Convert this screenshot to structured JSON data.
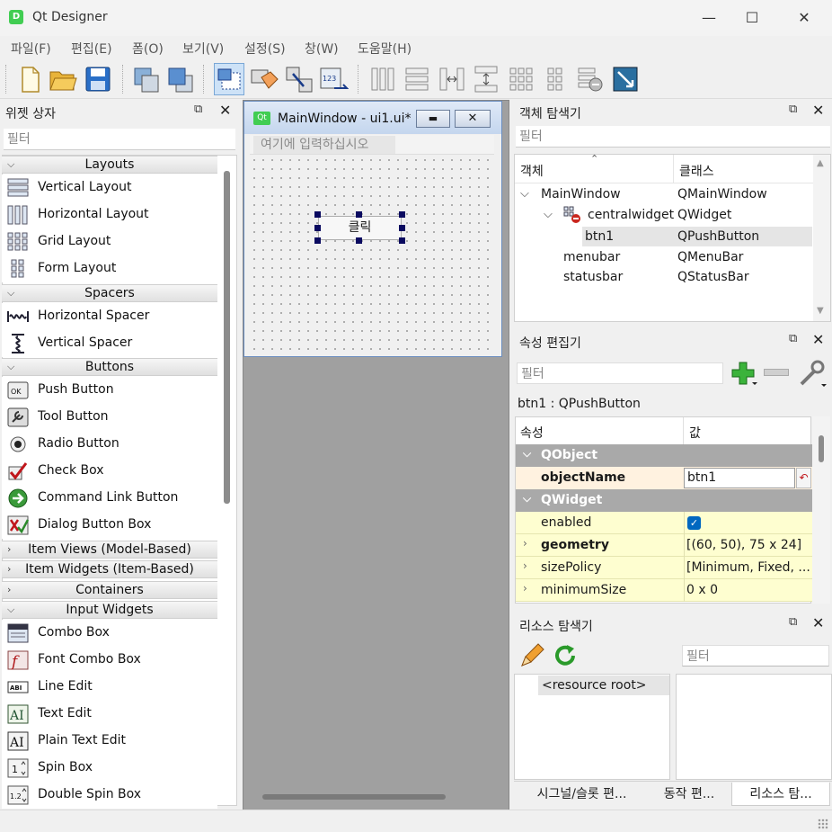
{
  "app": {
    "title": "Qt Designer",
    "logo": "D"
  },
  "window_controls": {
    "minimize": "—",
    "maximize": "☐",
    "close": "✕"
  },
  "menu": [
    "파일(F)",
    "편집(E)",
    "폼(O)",
    "보기(V)",
    "설정(S)",
    "창(W)",
    "도움말(H)"
  ],
  "toolbar": [
    "new-file-icon",
    "open-folder-icon",
    "save-icon",
    "send-to-back-icon",
    "bring-to-front-icon",
    "edit-widgets-icon",
    "edit-buddies-icon",
    "edit-signals-icon",
    "edit-tab-order-icon",
    "layout-horizontal-icon",
    "layout-vertical-icon",
    "layout-horizontal-splitter-icon",
    "layout-vertical-splitter-icon",
    "layout-grid-icon",
    "layout-form-icon",
    "break-layout-icon",
    "adjust-size-icon"
  ],
  "widget_box": {
    "title": "위젯 상자",
    "filter_placeholder": "필터",
    "cat_layouts": "Layouts",
    "layouts": [
      "Vertical Layout",
      "Horizontal Layout",
      "Grid Layout",
      "Form Layout"
    ],
    "cat_spacers": "Spacers",
    "spacers": [
      "Horizontal Spacer",
      "Vertical Spacer"
    ],
    "cat_buttons": "Buttons",
    "buttons": [
      "Push Button",
      "Tool Button",
      "Radio Button",
      "Check Box",
      "Command Link Button",
      "Dialog Button Box"
    ],
    "cat_item_views": "Item Views (Model-Based)",
    "cat_item_widgets": "Item Widgets (Item-Based)",
    "cat_containers": "Containers",
    "cat_input": "Input Widgets",
    "inputs": [
      "Combo Box",
      "Font Combo Box",
      "Line Edit",
      "Text Edit",
      "Plain Text Edit",
      "Spin Box",
      "Double Spin Box"
    ]
  },
  "form": {
    "title": "MainWindow - ui1.ui*",
    "menu_placeholder": "여기에 입력하십시오",
    "button_text": "클릭"
  },
  "object_inspector": {
    "title": "객체 탐색기",
    "filter_placeholder": "필터",
    "col_object": "객체",
    "col_class": "클래스",
    "rows": [
      {
        "name": "MainWindow",
        "cls": "QMainWindow"
      },
      {
        "name": "centralwidget",
        "cls": "QWidget"
      },
      {
        "name": "btn1",
        "cls": "QPushButton"
      },
      {
        "name": "menubar",
        "cls": "QMenuBar"
      },
      {
        "name": "statusbar",
        "cls": "QStatusBar"
      }
    ]
  },
  "property_editor": {
    "title": "속성 편집기",
    "filter_placeholder": "필터",
    "subject": "btn1 : QPushButton",
    "col_property": "속성",
    "col_value": "값",
    "group_qobject": "QObject",
    "group_qwidget": "QWidget",
    "object_name_label": "objectName",
    "object_name_value": "btn1",
    "enabled_label": "enabled",
    "enabled_value": true,
    "geometry_label": "geometry",
    "geometry_value": "[(60, 50), 75 x 24]",
    "size_policy_label": "sizePolicy",
    "size_policy_value": "[Minimum, Fixed, ...",
    "minimum_size_label": "minimumSize",
    "minimum_size_value": "0 x 0"
  },
  "resource_browser": {
    "title": "리소스 탐색기",
    "filter_placeholder": "필터",
    "root": "<resource root>"
  },
  "bottom_tabs": [
    "시그널/슬롯 편...",
    "동작 편...",
    "리소스 탐..."
  ],
  "colors": {
    "accent": "#0078d7",
    "group_header": "#a9a9a9",
    "prop_yellow": "#fefed0",
    "selection": "#cde8ff",
    "qt_green": "#41cd52"
  }
}
